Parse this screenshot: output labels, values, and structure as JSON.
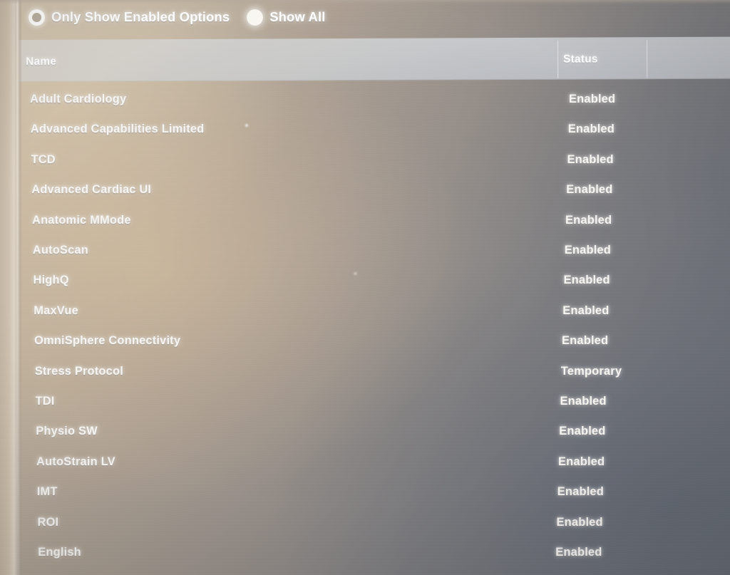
{
  "filter": {
    "options": [
      {
        "label": "Only Show Enabled Options",
        "icon": "radio-ring-icon",
        "selected": false
      },
      {
        "label": "Show All",
        "icon": "radio-filled-icon",
        "selected": true
      }
    ]
  },
  "table": {
    "columns": [
      {
        "key": "name",
        "label": "Name"
      },
      {
        "key": "status",
        "label": "Status"
      }
    ],
    "rows": [
      {
        "name": "Adult Cardiology",
        "status": "Enabled"
      },
      {
        "name": "Advanced Capabilities Limited",
        "status": "Enabled"
      },
      {
        "name": "TCD",
        "status": "Enabled"
      },
      {
        "name": "Advanced Cardiac UI",
        "status": "Enabled"
      },
      {
        "name": "Anatomic MMode",
        "status": "Enabled"
      },
      {
        "name": "AutoScan",
        "status": "Enabled"
      },
      {
        "name": "HighQ",
        "status": "Enabled"
      },
      {
        "name": "MaxVue",
        "status": "Enabled"
      },
      {
        "name": "OmniSphere Connectivity",
        "status": "Enabled"
      },
      {
        "name": "Stress Protocol",
        "status": "Temporary"
      },
      {
        "name": "TDI",
        "status": "Enabled"
      },
      {
        "name": "Physio SW",
        "status": "Enabled"
      },
      {
        "name": "AutoStrain LV",
        "status": "Enabled"
      },
      {
        "name": "IMT",
        "status": "Enabled"
      },
      {
        "name": "ROI",
        "status": "Enabled"
      },
      {
        "name": "English",
        "status": "Enabled"
      }
    ]
  },
  "colors": {
    "text": "#f7f5f2",
    "header_bar": "#c6c9cd",
    "bg_warm": "#cfc3b1",
    "bg_cool": "#6e737b"
  }
}
